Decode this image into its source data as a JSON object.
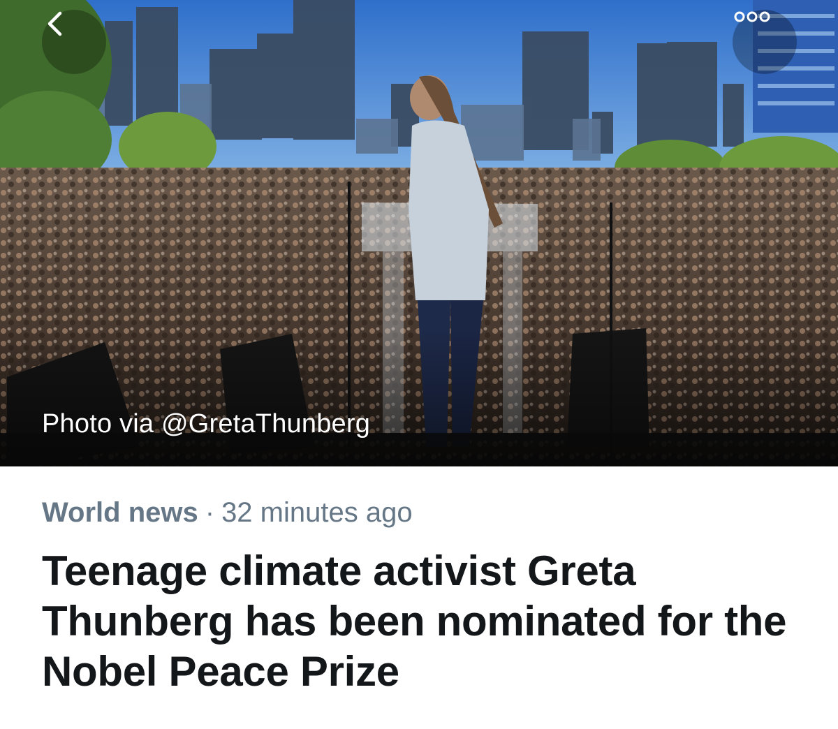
{
  "header": {
    "back_icon": "chevron-left-icon",
    "more_icon": "more-options-icon"
  },
  "hero": {
    "photo_credit": "Photo via @GretaThunberg"
  },
  "article": {
    "category": "World news",
    "separator": "·",
    "time_ago": "32 minutes ago",
    "headline": "Teenage climate activist Greta Thunberg has been nominated for the Nobel Peace Prize",
    "summary": ""
  },
  "colors": {
    "meta_text": "#657786",
    "headline_text": "#14171a",
    "sky": "#3d7fd0"
  }
}
